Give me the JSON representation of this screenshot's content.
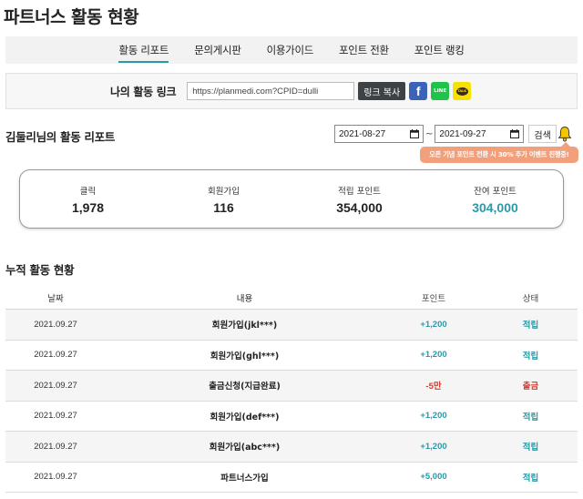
{
  "page_title": "파트너스 활동 현황",
  "tabs": [
    {
      "label": "활동 리포트",
      "active": true
    },
    {
      "label": "문의게시판",
      "active": false
    },
    {
      "label": "이용가이드",
      "active": false
    },
    {
      "label": "포인트 전환",
      "active": false
    },
    {
      "label": "포인트 랭킹",
      "active": false
    }
  ],
  "link_bar": {
    "label": "나의 활동 링크",
    "url_value": "https://planmedi.com?CPID=dulli",
    "copy_label": "링크 복사",
    "facebook_glyph": "f",
    "line_glyph": "LINE",
    "kakao_glyph": "TALK"
  },
  "report": {
    "title": "김둘리님의 활동 리포트",
    "start_date": "2021-08-27",
    "end_date": "2021-09-27",
    "date_separator": "~",
    "search_label": "검색",
    "promo_text": "오픈 기념 포인트 전환 시 30% 추가 이벤트 진행중!"
  },
  "stats": [
    {
      "label": "클릭",
      "value": "1,978",
      "accent": false
    },
    {
      "label": "회원가입",
      "value": "116",
      "accent": false
    },
    {
      "label": "적립 포인트",
      "value": "354,000",
      "accent": false
    },
    {
      "label": "잔여 포인트",
      "value": "304,000",
      "accent": true
    }
  ],
  "cumulative": {
    "title": "누적 활동 현황",
    "columns": [
      "날짜",
      "내용",
      "포인트",
      "상태"
    ],
    "rows": [
      {
        "date": "2021.09.27",
        "content": "회원가입(jkl***)",
        "point": "+1,200",
        "status": "적립",
        "type": "pos"
      },
      {
        "date": "2021.09.27",
        "content": "회원가입(ghl***)",
        "point": "+1,200",
        "status": "적립",
        "type": "pos"
      },
      {
        "date": "2021.09.27",
        "content": "출금신청(지급완료)",
        "point": "-5만",
        "status": "출금",
        "type": "neg"
      },
      {
        "date": "2021.09.27",
        "content": "회원가입(def***)",
        "point": "+1,200",
        "status": "적립",
        "type": "pos"
      },
      {
        "date": "2021.09.27",
        "content": "회원가입(abc***)",
        "point": "+1,200",
        "status": "적립",
        "type": "pos"
      },
      {
        "date": "2021.09.27",
        "content": "파트너스가입",
        "point": "+5,000",
        "status": "적립",
        "type": "pos"
      }
    ]
  },
  "colors": {
    "accent": "#2b9aa8",
    "negative": "#d63a2e",
    "promo": "#f2a07b"
  }
}
